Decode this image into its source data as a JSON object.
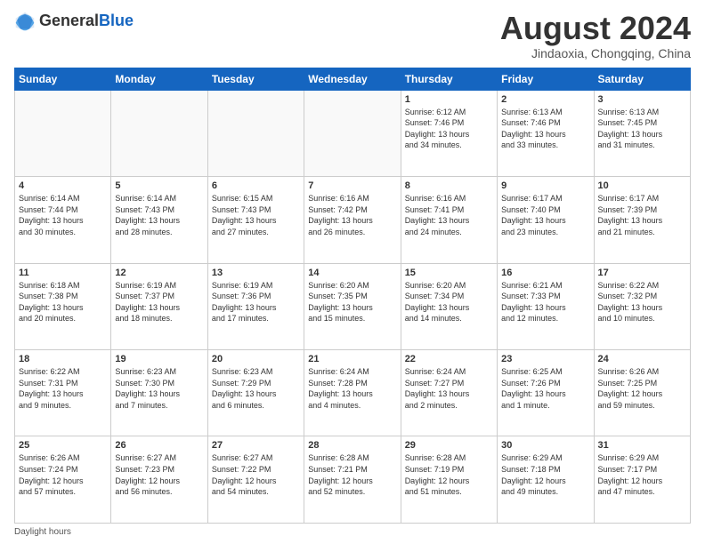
{
  "header": {
    "logo_general": "General",
    "logo_blue": "Blue",
    "month_title": "August 2024",
    "location": "Jindaoxia, Chongqing, China"
  },
  "weekdays": [
    "Sunday",
    "Monday",
    "Tuesday",
    "Wednesday",
    "Thursday",
    "Friday",
    "Saturday"
  ],
  "weeks": [
    [
      {
        "day": "",
        "info": ""
      },
      {
        "day": "",
        "info": ""
      },
      {
        "day": "",
        "info": ""
      },
      {
        "day": "",
        "info": ""
      },
      {
        "day": "1",
        "info": "Sunrise: 6:12 AM\nSunset: 7:46 PM\nDaylight: 13 hours\nand 34 minutes."
      },
      {
        "day": "2",
        "info": "Sunrise: 6:13 AM\nSunset: 7:46 PM\nDaylight: 13 hours\nand 33 minutes."
      },
      {
        "day": "3",
        "info": "Sunrise: 6:13 AM\nSunset: 7:45 PM\nDaylight: 13 hours\nand 31 minutes."
      }
    ],
    [
      {
        "day": "4",
        "info": "Sunrise: 6:14 AM\nSunset: 7:44 PM\nDaylight: 13 hours\nand 30 minutes."
      },
      {
        "day": "5",
        "info": "Sunrise: 6:14 AM\nSunset: 7:43 PM\nDaylight: 13 hours\nand 28 minutes."
      },
      {
        "day": "6",
        "info": "Sunrise: 6:15 AM\nSunset: 7:43 PM\nDaylight: 13 hours\nand 27 minutes."
      },
      {
        "day": "7",
        "info": "Sunrise: 6:16 AM\nSunset: 7:42 PM\nDaylight: 13 hours\nand 26 minutes."
      },
      {
        "day": "8",
        "info": "Sunrise: 6:16 AM\nSunset: 7:41 PM\nDaylight: 13 hours\nand 24 minutes."
      },
      {
        "day": "9",
        "info": "Sunrise: 6:17 AM\nSunset: 7:40 PM\nDaylight: 13 hours\nand 23 minutes."
      },
      {
        "day": "10",
        "info": "Sunrise: 6:17 AM\nSunset: 7:39 PM\nDaylight: 13 hours\nand 21 minutes."
      }
    ],
    [
      {
        "day": "11",
        "info": "Sunrise: 6:18 AM\nSunset: 7:38 PM\nDaylight: 13 hours\nand 20 minutes."
      },
      {
        "day": "12",
        "info": "Sunrise: 6:19 AM\nSunset: 7:37 PM\nDaylight: 13 hours\nand 18 minutes."
      },
      {
        "day": "13",
        "info": "Sunrise: 6:19 AM\nSunset: 7:36 PM\nDaylight: 13 hours\nand 17 minutes."
      },
      {
        "day": "14",
        "info": "Sunrise: 6:20 AM\nSunset: 7:35 PM\nDaylight: 13 hours\nand 15 minutes."
      },
      {
        "day": "15",
        "info": "Sunrise: 6:20 AM\nSunset: 7:34 PM\nDaylight: 13 hours\nand 14 minutes."
      },
      {
        "day": "16",
        "info": "Sunrise: 6:21 AM\nSunset: 7:33 PM\nDaylight: 13 hours\nand 12 minutes."
      },
      {
        "day": "17",
        "info": "Sunrise: 6:22 AM\nSunset: 7:32 PM\nDaylight: 13 hours\nand 10 minutes."
      }
    ],
    [
      {
        "day": "18",
        "info": "Sunrise: 6:22 AM\nSunset: 7:31 PM\nDaylight: 13 hours\nand 9 minutes."
      },
      {
        "day": "19",
        "info": "Sunrise: 6:23 AM\nSunset: 7:30 PM\nDaylight: 13 hours\nand 7 minutes."
      },
      {
        "day": "20",
        "info": "Sunrise: 6:23 AM\nSunset: 7:29 PM\nDaylight: 13 hours\nand 6 minutes."
      },
      {
        "day": "21",
        "info": "Sunrise: 6:24 AM\nSunset: 7:28 PM\nDaylight: 13 hours\nand 4 minutes."
      },
      {
        "day": "22",
        "info": "Sunrise: 6:24 AM\nSunset: 7:27 PM\nDaylight: 13 hours\nand 2 minutes."
      },
      {
        "day": "23",
        "info": "Sunrise: 6:25 AM\nSunset: 7:26 PM\nDaylight: 13 hours\nand 1 minute."
      },
      {
        "day": "24",
        "info": "Sunrise: 6:26 AM\nSunset: 7:25 PM\nDaylight: 12 hours\nand 59 minutes."
      }
    ],
    [
      {
        "day": "25",
        "info": "Sunrise: 6:26 AM\nSunset: 7:24 PM\nDaylight: 12 hours\nand 57 minutes."
      },
      {
        "day": "26",
        "info": "Sunrise: 6:27 AM\nSunset: 7:23 PM\nDaylight: 12 hours\nand 56 minutes."
      },
      {
        "day": "27",
        "info": "Sunrise: 6:27 AM\nSunset: 7:22 PM\nDaylight: 12 hours\nand 54 minutes."
      },
      {
        "day": "28",
        "info": "Sunrise: 6:28 AM\nSunset: 7:21 PM\nDaylight: 12 hours\nand 52 minutes."
      },
      {
        "day": "29",
        "info": "Sunrise: 6:28 AM\nSunset: 7:19 PM\nDaylight: 12 hours\nand 51 minutes."
      },
      {
        "day": "30",
        "info": "Sunrise: 6:29 AM\nSunset: 7:18 PM\nDaylight: 12 hours\nand 49 minutes."
      },
      {
        "day": "31",
        "info": "Sunrise: 6:29 AM\nSunset: 7:17 PM\nDaylight: 12 hours\nand 47 minutes."
      }
    ]
  ],
  "footer": {
    "daylight_label": "Daylight hours"
  }
}
